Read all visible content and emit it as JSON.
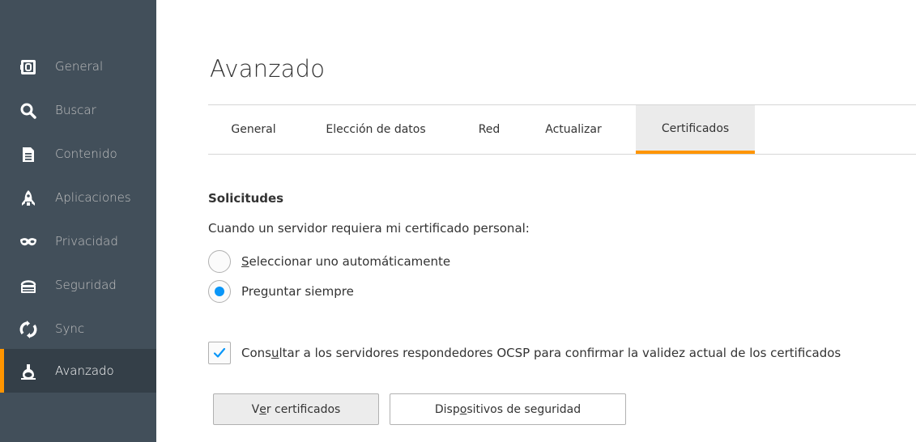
{
  "sidebar": {
    "items": [
      {
        "label": "General",
        "icon": "general-icon",
        "active": false
      },
      {
        "label": "Buscar",
        "icon": "search-icon",
        "active": false
      },
      {
        "label": "Contenido",
        "icon": "content-icon",
        "active": false
      },
      {
        "label": "Aplicaciones",
        "icon": "applications-icon",
        "active": false
      },
      {
        "label": "Privacidad",
        "icon": "privacy-mask-icon",
        "active": false
      },
      {
        "label": "Seguridad",
        "icon": "security-icon",
        "active": false
      },
      {
        "label": "Sync",
        "icon": "sync-icon",
        "active": false
      },
      {
        "label": "Avanzado",
        "icon": "advanced-icon",
        "active": true
      }
    ]
  },
  "main": {
    "title": "Avanzado",
    "tabs": [
      {
        "label": "General",
        "active": false
      },
      {
        "label": "Elección de datos",
        "active": false
      },
      {
        "label": "Red",
        "active": false
      },
      {
        "label": "Actualizar",
        "active": false
      },
      {
        "label": "Certificados",
        "active": true
      }
    ],
    "section_title": "Solicitudes",
    "description": "Cuando un servidor requiera mi certificado personal:",
    "radio_auto": {
      "pre": "",
      "accesskey": "S",
      "post": "eleccionar uno automáticamente",
      "checked": false
    },
    "radio_ask": {
      "pre": "Pre",
      "accesskey": "g",
      "post": "untar siempre",
      "checked": true
    },
    "ocsp": {
      "pre": "Cons",
      "accesskey": "u",
      "post": "ltar a los servidores respondedores OCSP para confirmar la validez actual de los certificados",
      "checked": true
    },
    "btn_view": {
      "pre": "V",
      "accesskey": "e",
      "post": "r certificados"
    },
    "btn_devices": {
      "pre": "Disp",
      "accesskey": "o",
      "post": "sitivos de seguridad"
    }
  },
  "colors": {
    "sidebar_bg": "#424f5a",
    "sidebar_active": "#343f48",
    "accent": "#ff9500",
    "radio_blue": "#0996f8"
  }
}
